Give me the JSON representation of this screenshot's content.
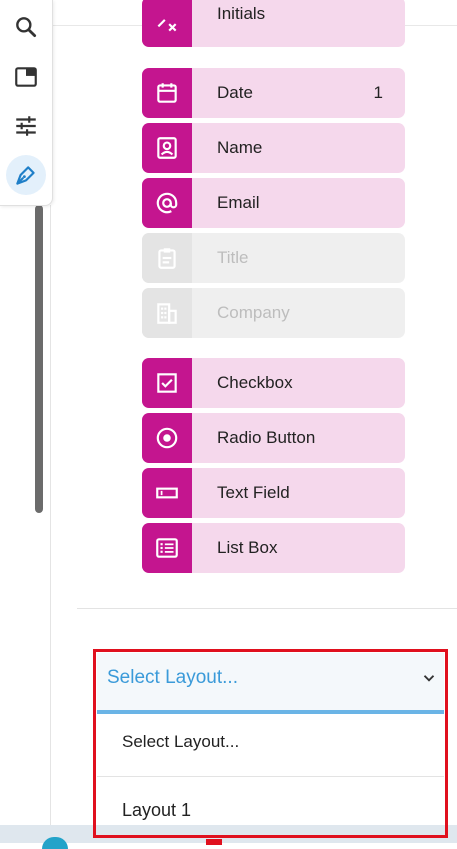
{
  "toolbar": {
    "tools": [
      {
        "name": "search",
        "icon": "search-icon",
        "active": false
      },
      {
        "name": "panel",
        "icon": "panel-icon",
        "active": false
      },
      {
        "name": "adjust",
        "icon": "sliders-icon",
        "active": false
      },
      {
        "name": "sign",
        "icon": "pen-nib-icon",
        "active": true
      }
    ]
  },
  "fields": {
    "initials": {
      "label": "Initials",
      "icon": "initials-icon"
    },
    "date": {
      "label": "Date",
      "count": "1",
      "icon": "calendar-icon"
    },
    "name": {
      "label": "Name",
      "icon": "contact-card-icon"
    },
    "email": {
      "label": "Email",
      "icon": "at-sign-icon"
    },
    "title": {
      "label": "Title",
      "icon": "clipboard-icon",
      "disabled": true
    },
    "company": {
      "label": "Company",
      "icon": "building-icon",
      "disabled": true
    },
    "checkbox": {
      "label": "Checkbox",
      "icon": "checkbox-icon"
    },
    "radio": {
      "label": "Radio Button",
      "icon": "radio-icon"
    },
    "textfield": {
      "label": "Text Field",
      "icon": "text-field-icon"
    },
    "listbox": {
      "label": "List Box",
      "icon": "list-box-icon"
    }
  },
  "layout_select": {
    "value": "Select Layout...",
    "options": [
      "Select Layout...",
      "Layout 1"
    ]
  },
  "colors": {
    "accent": "#c4158f",
    "field_bg": "#f5d8ec",
    "select_text": "#3a9ad9",
    "highlight": "#e0101e"
  }
}
